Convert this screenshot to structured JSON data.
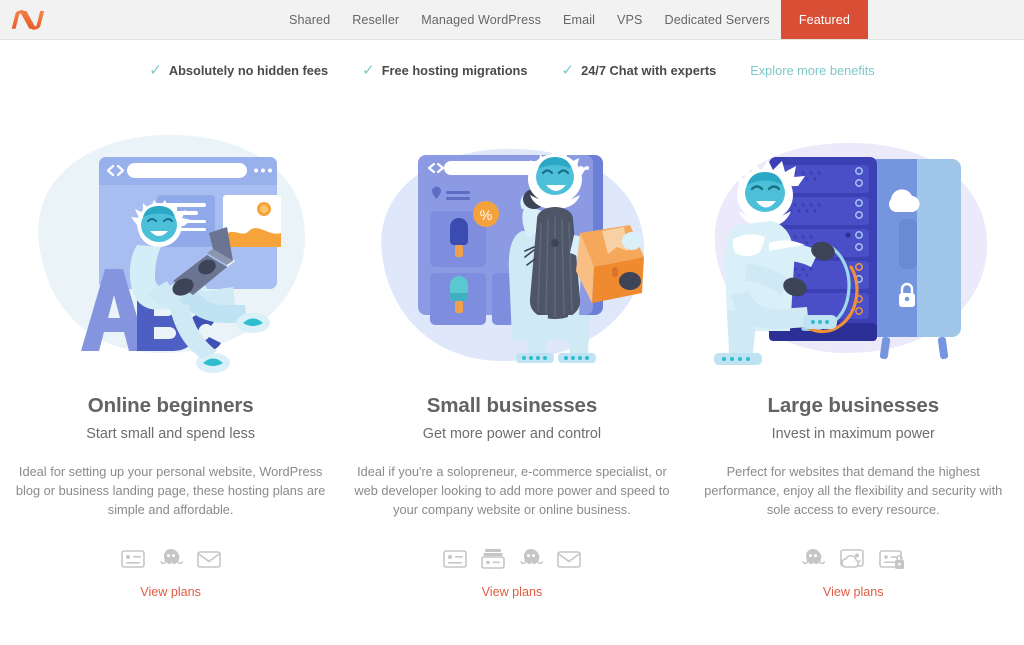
{
  "brand": {
    "logo_name": "namecheap-logo",
    "logo_color_light": "#f58a50",
    "logo_color_dark": "#e0562a",
    "accent_orange": "#d94f35",
    "link_orange": "#e05c43",
    "teal": "#7dc8c8"
  },
  "nav": {
    "items": [
      {
        "label": "Shared",
        "active": false
      },
      {
        "label": "Reseller",
        "active": false
      },
      {
        "label": "Managed WordPress",
        "active": false
      },
      {
        "label": "Email",
        "active": false
      },
      {
        "label": "VPS",
        "active": false
      },
      {
        "label": "Dedicated Servers",
        "active": false
      },
      {
        "label": "Featured",
        "active": true
      }
    ]
  },
  "benefits": {
    "items": [
      {
        "label": "Absolutely no hidden fees",
        "check": "✓"
      },
      {
        "label": "Free hosting migrations",
        "check": "✓"
      },
      {
        "label": "24/7 Chat with experts",
        "check": "✓"
      }
    ],
    "link_label": "Explore more benefits"
  },
  "cards": [
    {
      "illustration": "yeti-with-laptop-abc",
      "title": "Online beginners",
      "subtitle": "Start small and spend less",
      "description": "Ideal for setting up your personal website, WordPress blog or business landing page, these hosting plans are simple and affordable.",
      "icons": [
        "website-card-icon",
        "cpanel-octopus-icon",
        "email-envelope-icon"
      ],
      "cta_label": "View plans"
    },
    {
      "illustration": "yeti-shopkeeper-with-box",
      "title": "Small businesses",
      "subtitle": "Get more power and control",
      "description": "Ideal if you're a solopreneur, e-commerce specialist, or web developer looking to add more power and speed to your company website or online business.",
      "icons": [
        "website-card-icon",
        "multiple-websites-icon",
        "cpanel-octopus-icon",
        "email-envelope-icon"
      ],
      "cta_label": "View plans"
    },
    {
      "illustration": "yeti-with-server-rack",
      "title": "Large businesses",
      "subtitle": "Invest in maximum power",
      "description": "Perfect for websites that demand the highest performance, enjoy all the flexibility and security with sole access to every resource.",
      "icons": [
        "cpanel-octopus-icon",
        "cloud-storage-icon",
        "secure-server-icon"
      ],
      "cta_label": "View plans"
    }
  ]
}
